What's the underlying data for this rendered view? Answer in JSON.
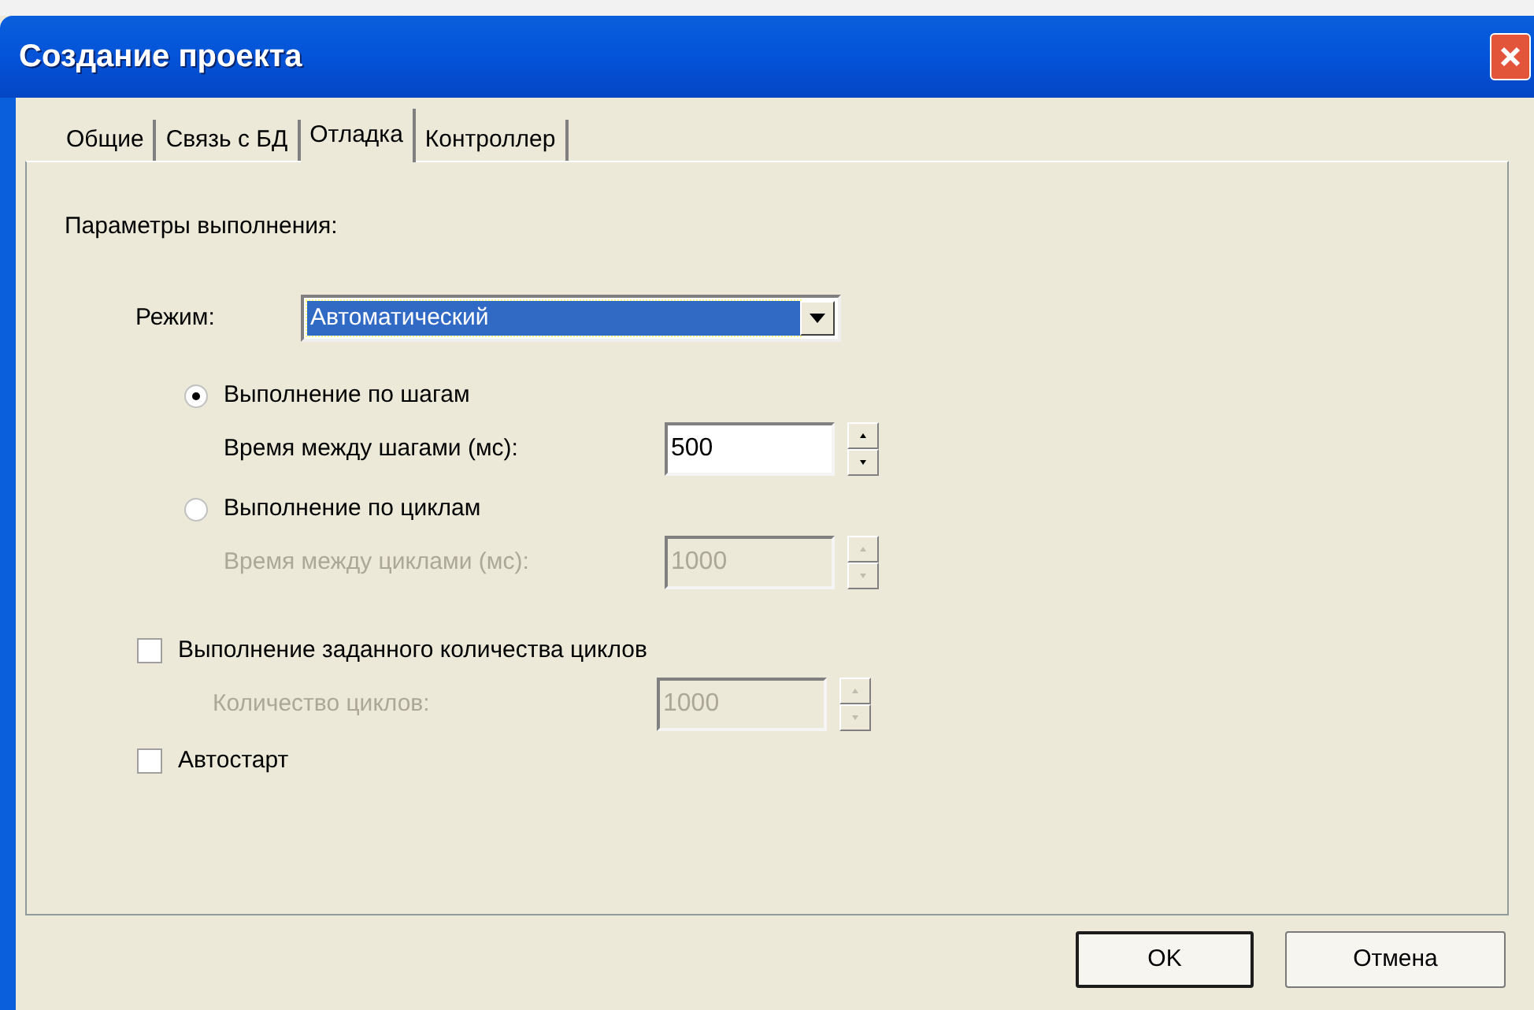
{
  "window": {
    "title": "Создание проекта"
  },
  "tabs": [
    {
      "label": "Общие",
      "selected": false
    },
    {
      "label": "Связь с БД",
      "selected": false
    },
    {
      "label": "Отладка",
      "selected": true
    },
    {
      "label": "Контроллер",
      "selected": false
    }
  ],
  "section_label": "Параметры выполнения:",
  "mode": {
    "label": "Режим:",
    "value": "Автоматический"
  },
  "options": [
    {
      "kind": "radio",
      "label": "Выполнение по шагам",
      "selected": true,
      "field": {
        "label": "Время между шагами (мс):",
        "value": "500",
        "disabled": false
      }
    },
    {
      "kind": "radio",
      "label": "Выполнение по циклам",
      "selected": false,
      "field": {
        "label": "Время между циклами (мс):",
        "value": "1000",
        "disabled": true
      }
    },
    {
      "kind": "checkbox",
      "label": "Выполнение заданного количества циклов",
      "checked": false,
      "field": {
        "label": "Количество циклов:",
        "value": "1000",
        "disabled": true
      }
    },
    {
      "kind": "checkbox",
      "label": "Автостарт",
      "checked": false
    }
  ],
  "buttons": [
    {
      "label": "OK",
      "default": true
    },
    {
      "label": "Отмена",
      "default": false
    }
  ]
}
